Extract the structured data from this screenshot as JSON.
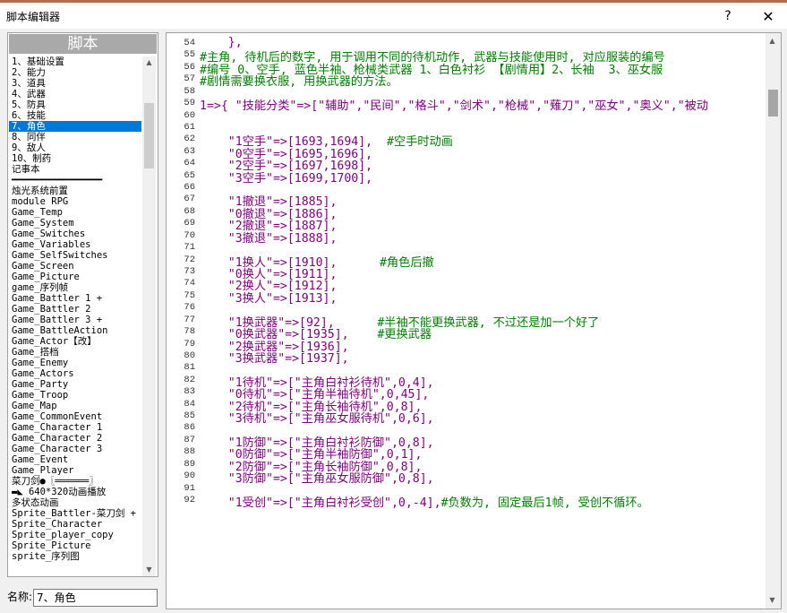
{
  "window": {
    "title": "脚本编辑器",
    "help_label": "?",
    "close_label": "✕"
  },
  "left_panel": {
    "header": "脚本",
    "selected_index": 6,
    "items": [
      "1、基础设置",
      "2、能力",
      "3、道具",
      "4、武器",
      "5、防具",
      "6、技能",
      "7、角色",
      "8、同伴",
      "9、敌人",
      "10、制药",
      "记事本",
      "━━━━━━━━━━━━━━━━",
      "烛光系统前置",
      "module RPG",
      "Game_Temp",
      "Game_System",
      "Game_Switches",
      "Game_Variables",
      "Game_SelfSwitches",
      "Game_Screen",
      "Game_Picture",
      "game_序列帧",
      "Game_Battler 1    +",
      "Game_Battler 2",
      "Game_Battler 3    +",
      "Game_BattleAction",
      "Game_Actor【改】",
      "Game_搭档",
      "Game_Enemy",
      "Game_Actors",
      "Game_Party",
      "Game_Troop",
      "Game_Map",
      "Game_CommonEvent",
      "Game_Character 1",
      "Game_Character 2",
      "Game_Character 3",
      "Game_Event",
      "Game_Player",
      "菜刀剑●〖══════〗",
      "▬◣ 640*320动画播放",
      "   多状态动画",
      "Sprite_Battler-菜刀剑 +",
      "Sprite_Character",
      "Sprite_player_copy",
      "Sprite_Picture",
      "sprite_序列图"
    ]
  },
  "name_field": {
    "label": "名称:",
    "value": "7、角色"
  },
  "editor": {
    "lines": [
      {
        "n": "54",
        "segs": [
          [
            "p",
            "    },"
          ]
        ]
      },
      {
        "n": "55",
        "segs": [
          [
            "g",
            "#主角, 待机后的数字, 用于调用不同的待机动作, 武器与技能使用时, 对应服装的编号"
          ]
        ]
      },
      {
        "n": "56",
        "segs": [
          [
            "g",
            "#编号 0、空手, 蓝色半袖、枪械类武器 1、白色衬衫 【剧情用】2、长袖  3、巫女服"
          ]
        ]
      },
      {
        "n": "57",
        "segs": [
          [
            "g",
            "#剧情需要换衣服, 用换武器的方法。"
          ]
        ]
      },
      {
        "n": "58",
        "segs": []
      },
      {
        "n": "59",
        "segs": [
          [
            "p",
            "1=>{ \"技能分类\"=>[\"辅助\",\"民间\",\"格斗\",\"剑术\",\"枪械\",\"薙刀\",\"巫女\",\"奥义\",\"被动"
          ]
        ]
      },
      {
        "n": "60",
        "segs": []
      },
      {
        "n": "61",
        "segs": []
      },
      {
        "n": "62",
        "segs": [
          [
            "p",
            "    \"1空手\"=>[1693,1694], "
          ],
          [
            "g",
            " #空手时动画"
          ]
        ]
      },
      {
        "n": "63",
        "segs": [
          [
            "p",
            "    \"0空手\"=>[1695,1696],"
          ]
        ]
      },
      {
        "n": "64",
        "segs": [
          [
            "p",
            "    \"2空手\"=>[1697,1698],"
          ]
        ]
      },
      {
        "n": "65",
        "segs": [
          [
            "p",
            "    \"3空手\"=>[1699,1700],"
          ]
        ]
      },
      {
        "n": "66",
        "segs": []
      },
      {
        "n": "67",
        "segs": [
          [
            "p",
            "    \"1撤退\"=>[1885],"
          ]
        ]
      },
      {
        "n": "68",
        "segs": [
          [
            "p",
            "    \"0撤退\"=>[1886],"
          ]
        ]
      },
      {
        "n": "69",
        "segs": [
          [
            "p",
            "    \"2撤退\"=>[1887],"
          ]
        ]
      },
      {
        "n": "70",
        "segs": [
          [
            "p",
            "    \"3撤退\"=>[1888],"
          ]
        ]
      },
      {
        "n": "71",
        "segs": []
      },
      {
        "n": "72",
        "segs": [
          [
            "p",
            "    \"1换人\"=>[1910],      "
          ],
          [
            "g",
            "#角色后撤"
          ]
        ]
      },
      {
        "n": "73",
        "segs": [
          [
            "p",
            "    \"0换人\"=>[1911],"
          ]
        ]
      },
      {
        "n": "74",
        "segs": [
          [
            "p",
            "    \"2换人\"=>[1912],"
          ]
        ]
      },
      {
        "n": "75",
        "segs": [
          [
            "p",
            "    \"3换人\"=>[1913],"
          ]
        ]
      },
      {
        "n": "76",
        "segs": []
      },
      {
        "n": "77",
        "segs": [
          [
            "p",
            "    \"1换武器\"=>[92],      "
          ],
          [
            "g",
            "#半袖不能更换武器, 不过还是加一个好了"
          ]
        ]
      },
      {
        "n": "78",
        "segs": [
          [
            "p",
            "    \"0换武器\"=>[1935],    "
          ],
          [
            "g",
            "#更换武器"
          ]
        ]
      },
      {
        "n": "79",
        "segs": [
          [
            "p",
            "    \"2换武器\"=>[1936],"
          ]
        ]
      },
      {
        "n": "80",
        "segs": [
          [
            "p",
            "    \"3换武器\"=>[1937],"
          ]
        ]
      },
      {
        "n": "81",
        "segs": []
      },
      {
        "n": "82",
        "segs": [
          [
            "p",
            "    \"1待机\"=>[\"主角白衬衫待机\",0,4],"
          ]
        ]
      },
      {
        "n": "83",
        "segs": [
          [
            "p",
            "    \"0待机\"=>[\"主角半袖待机\",0,45],"
          ]
        ]
      },
      {
        "n": "84",
        "segs": [
          [
            "p",
            "    \"2待机\"=>[\"主角长袖待机\",0,8],"
          ]
        ]
      },
      {
        "n": "85",
        "segs": [
          [
            "p",
            "    \"3待机\"=>[\"主角巫女服待机\",0,6],"
          ]
        ]
      },
      {
        "n": "86",
        "segs": []
      },
      {
        "n": "87",
        "segs": [
          [
            "p",
            "    \"1防御\"=>[\"主角白衬衫防御\",0,8],"
          ]
        ]
      },
      {
        "n": "88",
        "segs": [
          [
            "p",
            "    \"0防御\"=>[\"主角半袖防御\",0,1],"
          ]
        ]
      },
      {
        "n": "89",
        "segs": [
          [
            "p",
            "    \"2防御\"=>[\"主角长袖防御\",0,8],"
          ]
        ]
      },
      {
        "n": "90",
        "segs": [
          [
            "p",
            "    \"3防御\"=>[\"主角巫女服防御\",0,8],"
          ]
        ]
      },
      {
        "n": "91",
        "segs": []
      },
      {
        "n": "92",
        "segs": [
          [
            "p",
            "    \"1受创\"=>[\"主角白衬衫受创\",0,-4],"
          ],
          [
            "g",
            "#负数为, 固定最后1帧, 受创不循环。"
          ]
        ]
      }
    ]
  },
  "colors": {
    "selection": "#0078d7",
    "string": "#800080",
    "comment": "#008000",
    "header_bg": "#a9a9a9"
  }
}
